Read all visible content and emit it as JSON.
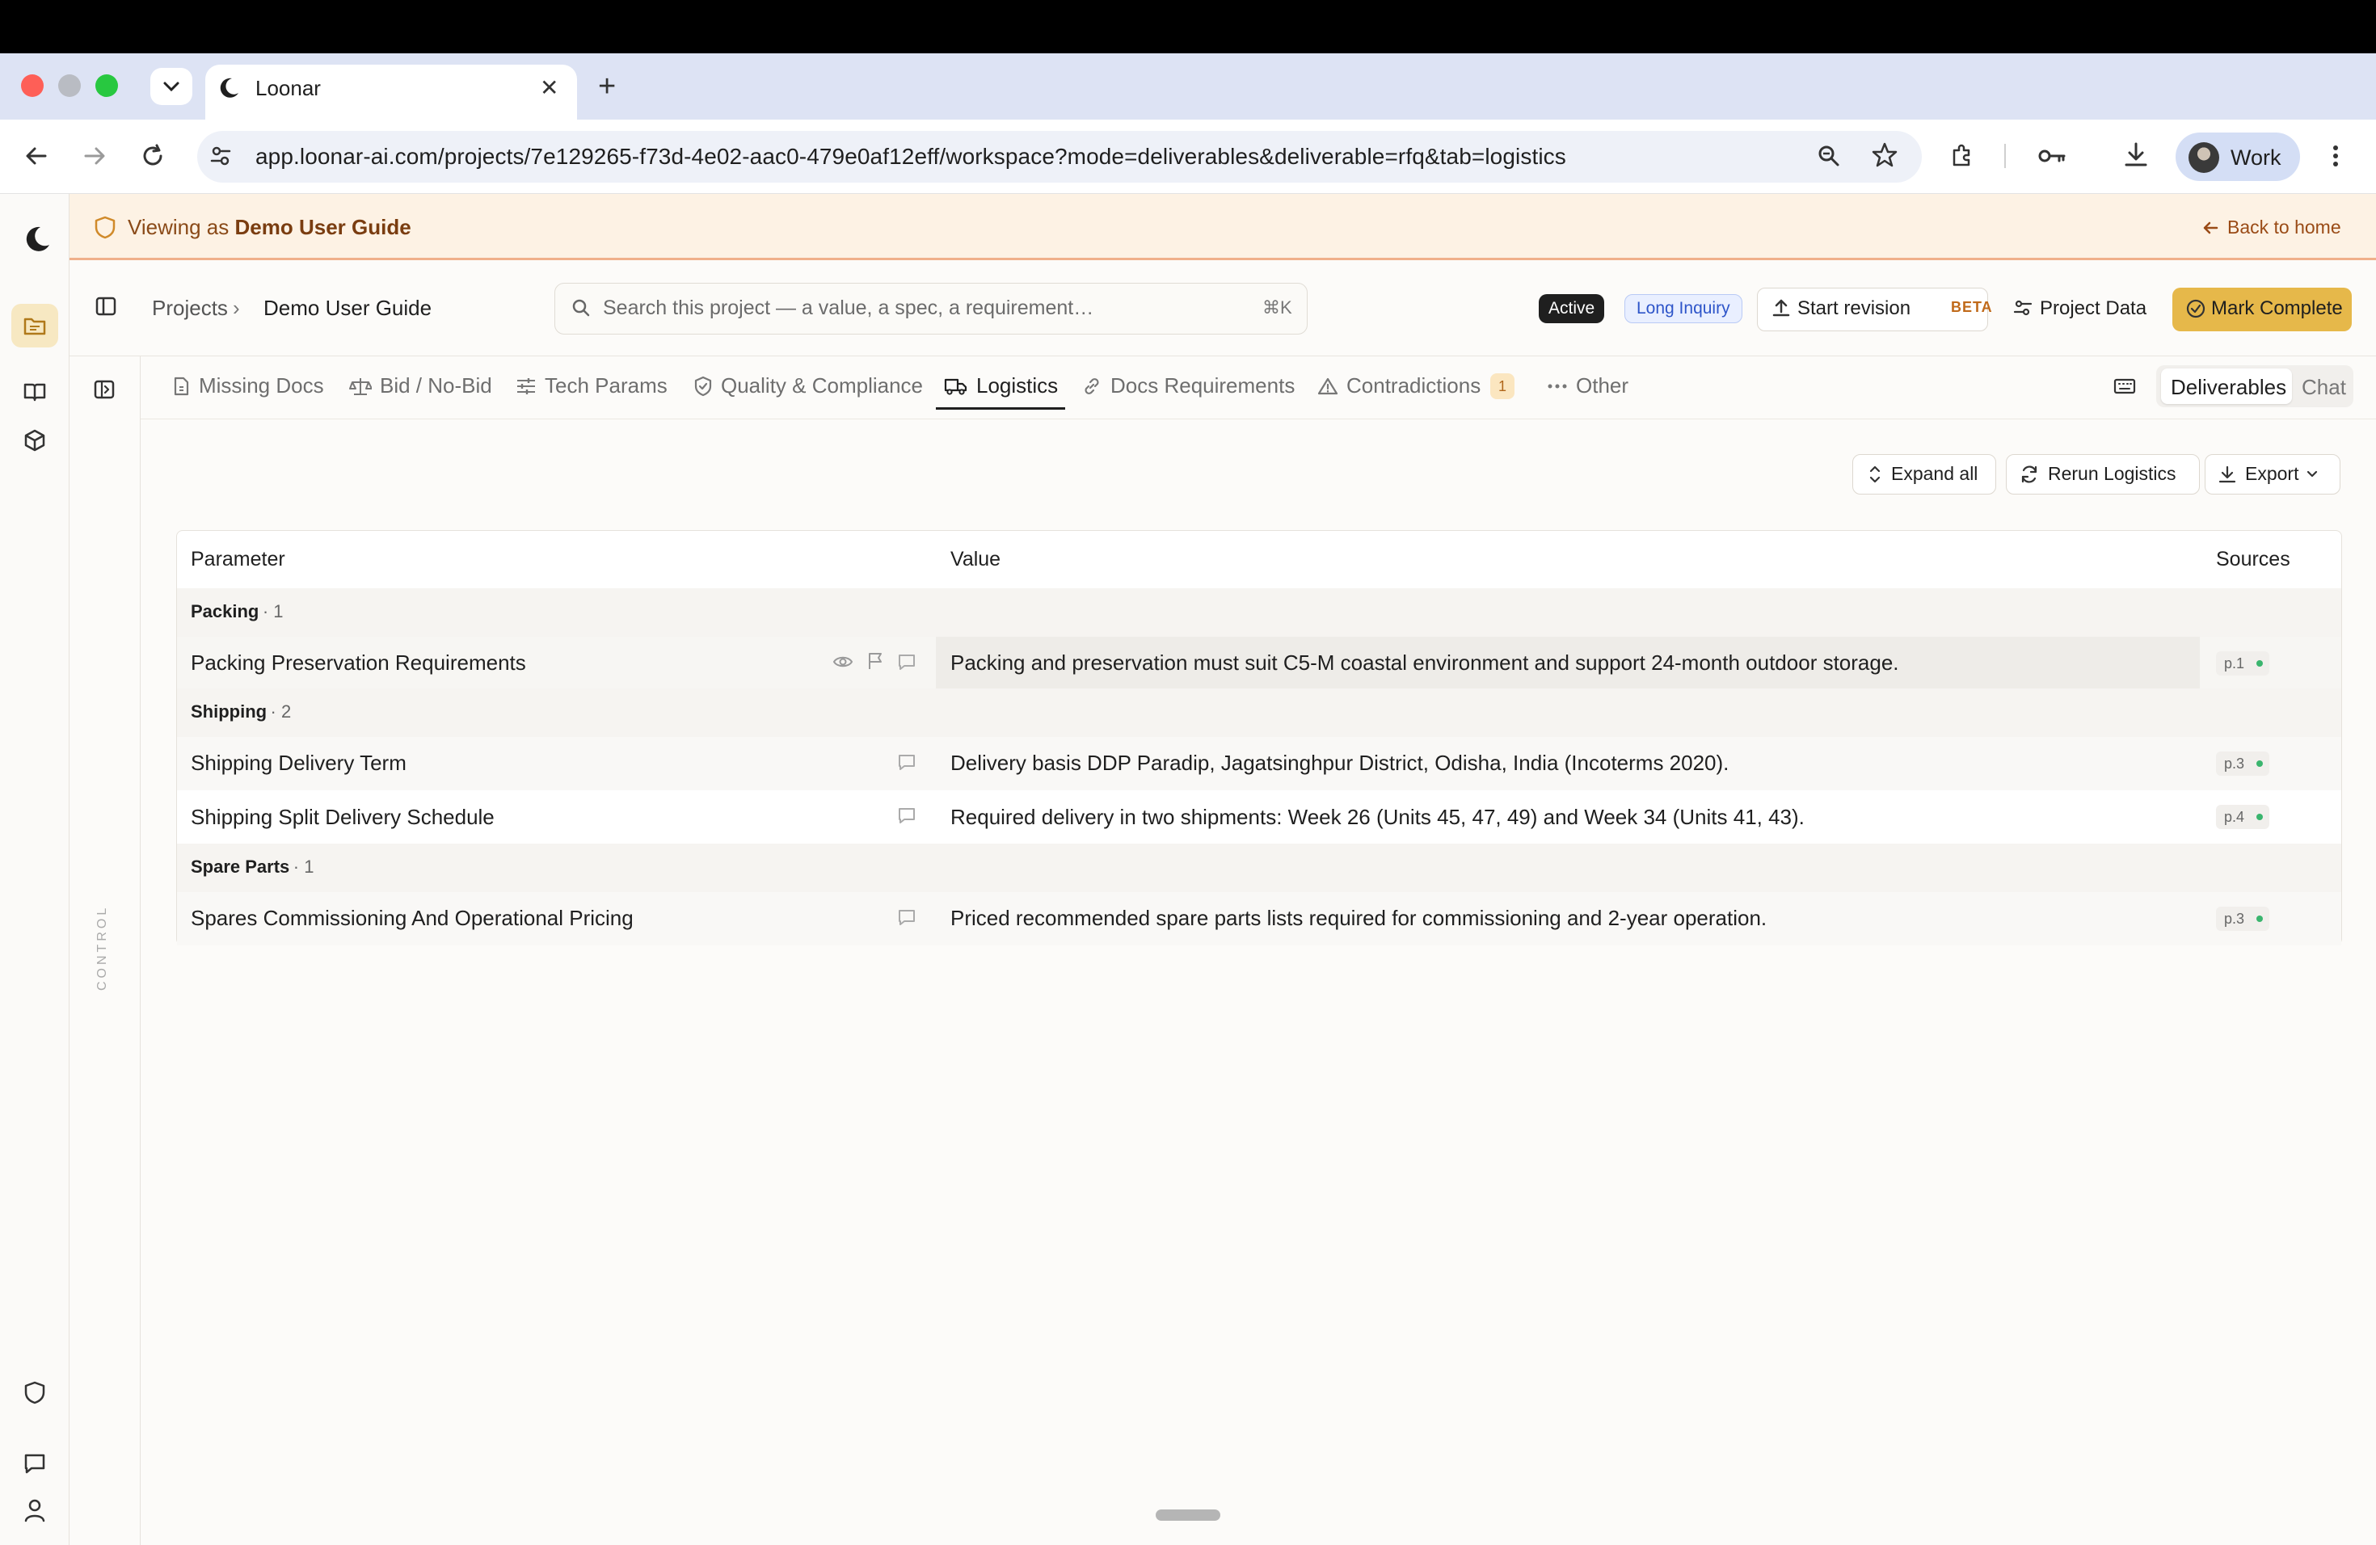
{
  "browser": {
    "tab_title": "Loonar",
    "url": "app.loonar-ai.com/projects/7e129265-f73d-4e02-aac0-479e0af12eff/workspace?mode=deliverables&deliverable=rfq&tab=logistics",
    "profile_label": "Work"
  },
  "banner": {
    "prefix": "Viewing as",
    "user": "Demo User Guide",
    "back_label": "Back to home"
  },
  "header": {
    "breadcrumb_root": "Projects",
    "breadcrumb_sep": "›",
    "breadcrumb_project": "Demo User Guide",
    "search_placeholder": "Search this project — a value, a spec, a requirement…",
    "search_shortcut": "⌘K",
    "status_badge": "Active",
    "type_badge": "Long Inquiry",
    "revision_label": "Start revision",
    "beta_label": "BETA",
    "project_data_label": "Project Data",
    "complete_label": "Mark Complete"
  },
  "rail": {
    "control_label": "CONTROL"
  },
  "tabs": {
    "items": [
      {
        "label": "Missing Docs"
      },
      {
        "label": "Bid / No-Bid"
      },
      {
        "label": "Tech Params"
      },
      {
        "label": "Quality & Compliance"
      },
      {
        "label": "Logistics"
      },
      {
        "label": "Docs Requirements"
      },
      {
        "label": "Contradictions"
      },
      {
        "label": "Other"
      }
    ],
    "active": "Logistics",
    "contradictions_count": "1",
    "view_deliverables": "Deliverables",
    "view_chat": "Chat"
  },
  "actions": {
    "expand_label": "Expand all",
    "rerun_label": "Rerun Logistics",
    "export_label": "Export"
  },
  "table": {
    "headers": {
      "parameter": "Parameter",
      "value": "Value",
      "sources": "Sources"
    },
    "groups": [
      {
        "name": "Packing",
        "count": "· 1",
        "rows": [
          {
            "parameter": "Packing Preservation Requirements",
            "value": "Packing and preservation must suit C5-M coastal environment and support 24-month outdoor storage.",
            "source": "p.1"
          }
        ]
      },
      {
        "name": "Shipping",
        "count": "· 2",
        "rows": [
          {
            "parameter": "Shipping Delivery Term",
            "value": "Delivery basis DDP Paradip, Jagatsinghpur District, Odisha, India (Incoterms 2020).",
            "source": "p.3"
          },
          {
            "parameter": "Shipping Split Delivery Schedule",
            "value": "Required delivery in two shipments: Week 26 (Units 45, 47, 49) and Week 34 (Units 41, 43).",
            "source": "p.4"
          }
        ]
      },
      {
        "name": "Spare Parts",
        "count": "· 1",
        "rows": [
          {
            "parameter": "Spares Commissioning And Operational Pricing",
            "value": "Priced recommended spare parts lists required for commissioning and 2-year operation.",
            "source": "p.3"
          }
        ]
      }
    ]
  },
  "colors": {
    "accent": "#e6b84a",
    "banner_bg": "#fdf2e4",
    "source_dot": "#3ab56e",
    "chrome_tabstrip": "#dde3f4"
  }
}
